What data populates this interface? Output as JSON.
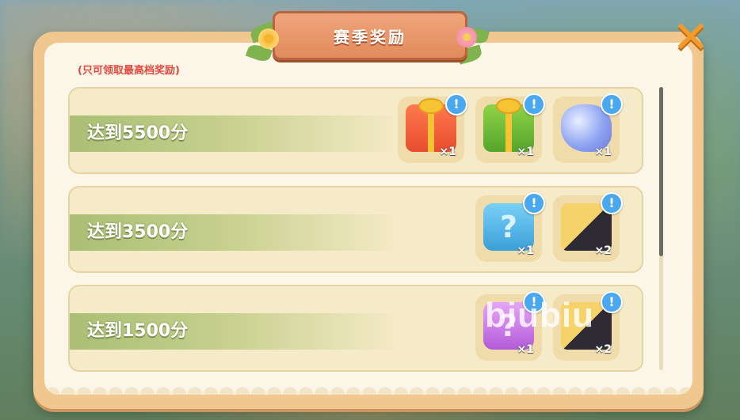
{
  "title": "赛季奖励",
  "note": "(只可领取最高档奖励)",
  "close_icon": "close-icon",
  "info_icon_glyph": "!",
  "tiers": [
    {
      "label": "达到5500分",
      "rewards": [
        {
          "icon": "red-gift-box-icon",
          "qty": "×1"
        },
        {
          "icon": "green-gift-box-icon",
          "qty": "×1"
        },
        {
          "icon": "crystal-icon",
          "qty": "×1"
        }
      ]
    },
    {
      "label": "达到3500分",
      "rewards": [
        {
          "icon": "blue-mystery-box-icon",
          "qty": "×1"
        },
        {
          "icon": "house-box-icon",
          "qty": "×2"
        }
      ]
    },
    {
      "label": "达到1500分",
      "rewards": [
        {
          "icon": "purple-mystery-box-icon",
          "qty": "×1"
        },
        {
          "icon": "house-box-icon",
          "qty": "×2"
        }
      ]
    }
  ],
  "watermark": "biubiu",
  "colors": {
    "panel_frame": "#f0c88f",
    "banner": "#e08b5d",
    "note_red": "#e2483f",
    "info_blue": "#49a8ee",
    "close_orange": "#f39a2c"
  }
}
